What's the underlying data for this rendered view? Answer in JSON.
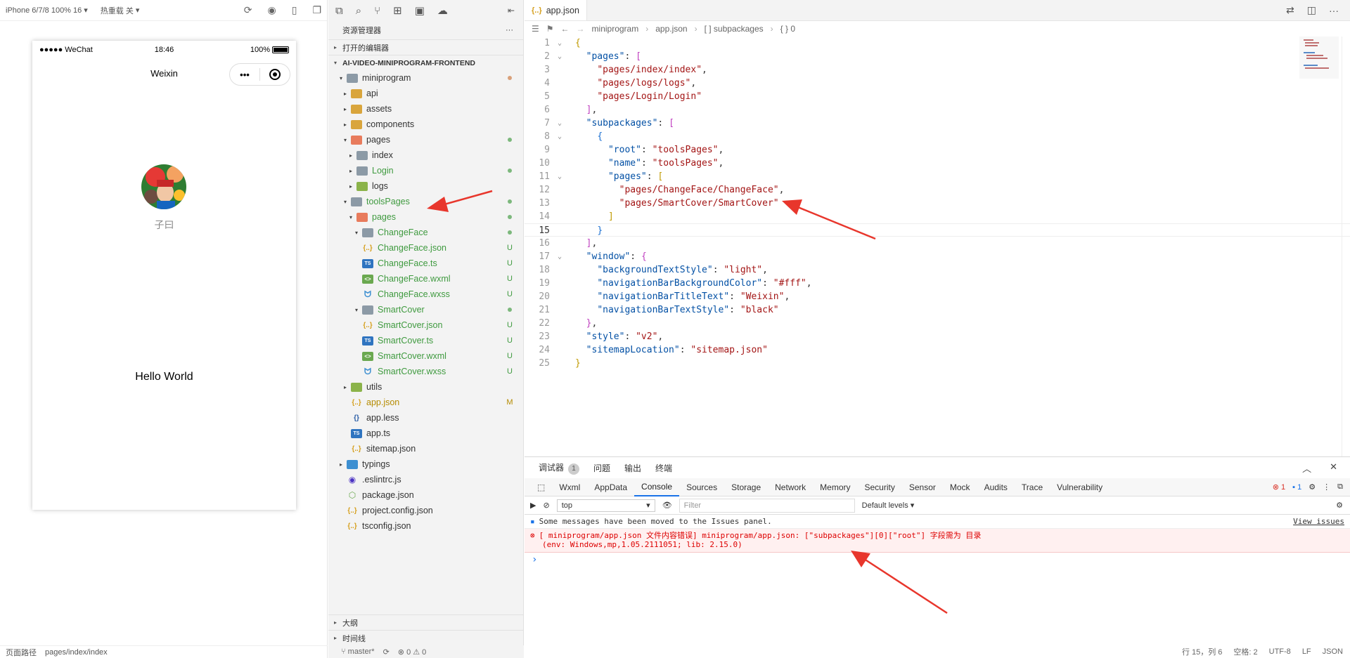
{
  "simulator": {
    "device": "iPhone 6/7/8 100% 16",
    "hot_reload": "热重载 关",
    "status": {
      "carrier": "●●●●● WeChat",
      "time": "18:46",
      "battery": "100%"
    },
    "nav_title": "Weixin",
    "user_name": "子曰",
    "hello": "Hello World",
    "bottom": {
      "path_label": "页面路径",
      "path": "pages/index/index"
    }
  },
  "explorer": {
    "title": "资源管理器",
    "more": "···",
    "open_editors": "打开的编辑器",
    "project": "AI-VIDEO-MINIPROGRAM-FRONTEND",
    "tree": [
      {
        "name": "miniprogram",
        "badge": "dot-orange"
      },
      {
        "name": "api",
        "badge": ""
      },
      {
        "name": "assets",
        "badge": ""
      },
      {
        "name": "components",
        "badge": ""
      },
      {
        "name": "pages",
        "badge": "dot-green"
      },
      {
        "name": "index",
        "badge": ""
      },
      {
        "name": "Login",
        "badge": "dot-green"
      },
      {
        "name": "logs",
        "badge": ""
      },
      {
        "name": "toolsPages",
        "badge": "dot-green"
      },
      {
        "name": "pages",
        "badge": "dot-green"
      },
      {
        "name": "ChangeFace",
        "badge": "dot-green"
      },
      {
        "name": "ChangeFace.json",
        "badge": "U"
      },
      {
        "name": "ChangeFace.ts",
        "badge": "U"
      },
      {
        "name": "ChangeFace.wxml",
        "badge": "U"
      },
      {
        "name": "ChangeFace.wxss",
        "badge": "U"
      },
      {
        "name": "SmartCover",
        "badge": "dot-green"
      },
      {
        "name": "SmartCover.json",
        "badge": "U"
      },
      {
        "name": "SmartCover.ts",
        "badge": "U"
      },
      {
        "name": "SmartCover.wxml",
        "badge": "U"
      },
      {
        "name": "SmartCover.wxss",
        "badge": "U"
      },
      {
        "name": "utils",
        "badge": ""
      },
      {
        "name": "app.json",
        "badge": "M"
      },
      {
        "name": "app.less",
        "badge": ""
      },
      {
        "name": "app.ts",
        "badge": ""
      },
      {
        "name": "sitemap.json",
        "badge": ""
      },
      {
        "name": "typings",
        "badge": ""
      },
      {
        "name": ".eslintrc.js",
        "badge": ""
      },
      {
        "name": "package.json",
        "badge": ""
      },
      {
        "name": "project.config.json",
        "badge": ""
      },
      {
        "name": "tsconfig.json",
        "badge": ""
      }
    ],
    "outline": "大纲",
    "timeline": "时间线",
    "status": {
      "branch": "master*",
      "errors": "0",
      "warnings": "0"
    }
  },
  "editor": {
    "tab": "app.json",
    "breadcrumbs": [
      "miniprogram",
      "app.json",
      "[ ] subpackages",
      "{ } 0"
    ],
    "lines": [
      "1",
      "2",
      "3",
      "4",
      "5",
      "6",
      "7",
      "8",
      "9",
      "10",
      "11",
      "12",
      "13",
      "14",
      "15",
      "16",
      "17",
      "18",
      "19",
      "20",
      "21",
      "22",
      "23",
      "24",
      "25"
    ],
    "code": {
      "pages_key": "\"pages\"",
      "index": "\"pages/index/index\"",
      "logs": "\"pages/logs/logs\"",
      "login": "\"pages/Login/Login\"",
      "subpackages_key": "\"subpackages\"",
      "root_key": "\"root\"",
      "root_val": "\"toolsPages\"",
      "name_key": "\"name\"",
      "name_val": "\"toolsPages\"",
      "sub_pages_key": "\"pages\"",
      "changeface": "\"pages/ChangeFace/ChangeFace\"",
      "smartcover": "\"pages/SmartCover/SmartCover\"",
      "window_key": "\"window\"",
      "bts_key": "\"backgroundTextStyle\"",
      "bts_val": "\"light\"",
      "nbbc_key": "\"navigationBarBackgroundColor\"",
      "nbbc_val": "\"#fff\"",
      "nbtt_key": "\"navigationBarTitleText\"",
      "nbtt_val": "\"Weixin\"",
      "nbts_key": "\"navigationBarTextStyle\"",
      "nbts_val": "\"black\"",
      "style_key": "\"style\"",
      "style_val": "\"v2\"",
      "sitemap_key": "\"sitemapLocation\"",
      "sitemap_val": "\"sitemap.json\""
    }
  },
  "debug": {
    "tabs": [
      {
        "label": "调试器",
        "badge": "1"
      },
      {
        "label": "问题",
        "badge": ""
      },
      {
        "label": "输出",
        "badge": ""
      },
      {
        "label": "终端",
        "badge": ""
      }
    ],
    "devtools_tabs": [
      "Wxml",
      "AppData",
      "Console",
      "Sources",
      "Storage",
      "Network",
      "Memory",
      "Security",
      "Sensor",
      "Mock",
      "Audits",
      "Trace",
      "Vulnerability"
    ],
    "active_tab": "Console",
    "error_count": "1",
    "info_count": "1",
    "context": "top",
    "filter_placeholder": "Filter",
    "levels": "Default levels",
    "info_msg": "Some messages have been moved to the Issues panel.",
    "view_issues": "View issues",
    "error_line1": "[ miniprogram/app.json 文件内容错误] miniprogram/app.json: [\"subpackages\"][0][\"root\"] 字段需为 目录",
    "error_line2": "(env: Windows,mp,1.05.2111051; lib: 2.15.0)",
    "prompt": "›"
  },
  "status_right": {
    "pos": "行 15，列 6",
    "spaces": "空格: 2",
    "encoding": "UTF-8",
    "eol": "LF",
    "lang": "JSON"
  },
  "colors": {
    "accent": "#1a73e8",
    "error": "#d93025",
    "arrow": "#e8362c",
    "git_untracked": "#3f9a3f",
    "git_modified": "#b58b00"
  }
}
